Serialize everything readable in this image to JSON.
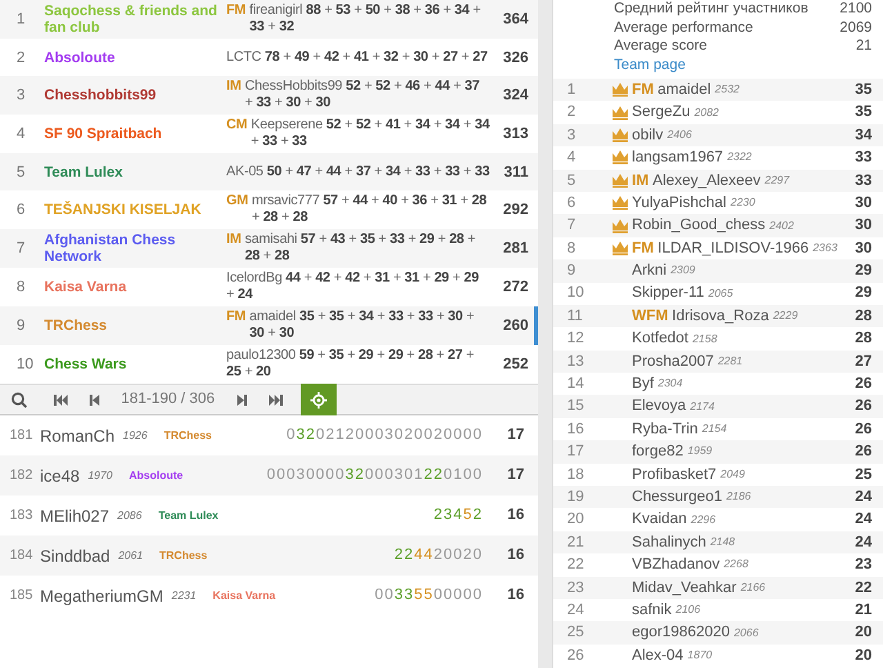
{
  "teams": [
    {
      "rank": "1",
      "name": "Saqochess & friends and fan club",
      "color": "#8cc63f",
      "title": "FM",
      "leader": "fireanigirl",
      "scores": "**88** + **53** + **50** + **38** + **36** + **34** + **33** + **32**",
      "total": "364",
      "selected": false
    },
    {
      "rank": "2",
      "name": "Absoloute",
      "color": "#a33cf0",
      "leader": "LCTC",
      "scores": "**78** + **49** + **42** + **41** + **32** + **30** + **27** + **27**",
      "total": "326",
      "selected": false
    },
    {
      "rank": "3",
      "name": "Chesshobbits99",
      "color": "#b03a34",
      "title": "IM",
      "leader": "ChessHobbits99",
      "scores": "**52** + **52** + **46** + **44** + **37** + **33** + **30** + **30**",
      "total": "324",
      "selected": false
    },
    {
      "rank": "4",
      "name": "SF 90 Spraitbach",
      "color": "#ec5a1e",
      "title": "CM",
      "leader": "Keepserene",
      "scores": "**52** + **52** + **41** + **34** + **34** + **34** + **33** + **33**",
      "total": "313",
      "selected": false
    },
    {
      "rank": "5",
      "name": "Team Lulex",
      "color": "#2e8b57",
      "leader": "AK-05",
      "scores": "**50** + **47** + **44** + **37** + **34** + **33** + **33** + **33**",
      "total": "311",
      "selected": false
    },
    {
      "rank": "6",
      "name": "TEŠANJSKI KISELJAK",
      "color": "#e0a224",
      "title": "GM",
      "leader": "mrsavic777",
      "scores": "**57** + **44** + **40** + **36** + **31** + **28** + **28** + **28**",
      "total": "292",
      "selected": false
    },
    {
      "rank": "7",
      "name": "Afghanistan Chess Network",
      "color": "#5c5cf0",
      "title": "IM",
      "leader": "samisahi",
      "scores": "**57** + **43** + **35** + **33** + **29** + **28** + **28** + **28**",
      "total": "281",
      "selected": false
    },
    {
      "rank": "8",
      "name": "Kaisa Varna",
      "color": "#e8735e",
      "leader": "IcelordBg",
      "scores": "**44** + **42** + **42** + **31** + **31** + **29** + **29** + **24**",
      "total": "272",
      "selected": false
    },
    {
      "rank": "9",
      "name": "TRChess",
      "color": "#d48a30",
      "title": "FM",
      "leader": "amaidel",
      "scores": "**35** + **35** + **34** + **33** + **33** + **30** + **30** + **30**",
      "total": "260",
      "selected": true
    },
    {
      "rank": "10",
      "name": "Chess Wars",
      "color": "#3c9a1e",
      "leader": "paulo12300",
      "scores": "**59** + **35** + **29** + **29** + **28** + **27** + **25** + **20**",
      "total": "252",
      "selected": false
    }
  ],
  "pager": {
    "range": "181-190 / 306"
  },
  "players": [
    {
      "rank": "181",
      "name": "RomanCh",
      "rating": "1926",
      "team": "TRChess",
      "color": "#d48a30",
      "sheet": [
        {
          "text": "0",
          "kind": "plain"
        },
        {
          "text": "32",
          "kind": "streak"
        },
        {
          "text": "02120003020020000",
          "kind": "plain"
        }
      ],
      "total": "17"
    },
    {
      "rank": "182",
      "name": "ice48",
      "rating": "1970",
      "team": "Absoloute",
      "color": "#a33cf0",
      "sheet": [
        {
          "text": "00030000",
          "kind": "plain"
        },
        {
          "text": "32",
          "kind": "streak"
        },
        {
          "text": "000301",
          "kind": "plain"
        },
        {
          "text": "22",
          "kind": "streak"
        },
        {
          "text": "0100",
          "kind": "plain"
        }
      ],
      "total": "17"
    },
    {
      "rank": "183",
      "name": "MElih027",
      "rating": "2086",
      "team": "Team Lulex",
      "color": "#2e8b57",
      "sheet": [
        {
          "text": "234",
          "kind": "streak"
        },
        {
          "text": "5",
          "kind": "double"
        },
        {
          "text": "2",
          "kind": "streak"
        }
      ],
      "total": "16"
    },
    {
      "rank": "184",
      "name": "Sinddbad",
      "rating": "2061",
      "team": "TRChess",
      "color": "#d48a30",
      "sheet": [
        {
          "text": "22",
          "kind": "streak"
        },
        {
          "text": "44",
          "kind": "double"
        },
        {
          "text": "20020",
          "kind": "plain"
        }
      ],
      "total": "16"
    },
    {
      "rank": "185",
      "name": "MegatheriumGM",
      "rating": "2231",
      "team": "Kaisa Varna",
      "color": "#e8735e",
      "sheet": [
        {
          "text": "00",
          "kind": "plain"
        },
        {
          "text": "33",
          "kind": "streak"
        },
        {
          "text": "55",
          "kind": "double"
        },
        {
          "text": "00000",
          "kind": "plain"
        }
      ],
      "total": "16"
    }
  ],
  "team_info": {
    "stats": [
      {
        "label": "Средний рейтинг участников",
        "value": "2100"
      },
      {
        "label": "Average performance",
        "value": "2069"
      },
      {
        "label": "Average score",
        "value": "21"
      }
    ],
    "link": "Team page"
  },
  "members": [
    {
      "rank": "1",
      "crown": true,
      "title": "FM",
      "name": "amaidel",
      "rating": "2532",
      "score": "35"
    },
    {
      "rank": "2",
      "crown": true,
      "name": "SergeZu",
      "rating": "2082",
      "score": "35"
    },
    {
      "rank": "3",
      "crown": true,
      "name": "obilv",
      "rating": "2406",
      "score": "34"
    },
    {
      "rank": "4",
      "crown": true,
      "name": "langsam1967",
      "rating": "2322",
      "score": "33"
    },
    {
      "rank": "5",
      "crown": true,
      "title": "IM",
      "name": "Alexey_Alexeev",
      "rating": "2297",
      "score": "33"
    },
    {
      "rank": "6",
      "crown": true,
      "name": "YulyaPishchal",
      "rating": "2230",
      "score": "30"
    },
    {
      "rank": "7",
      "crown": true,
      "name": "Robin_Good_chess",
      "rating": "2402",
      "score": "30"
    },
    {
      "rank": "8",
      "crown": true,
      "title": "FM",
      "name": "ILDAR_ILDISOV-1966",
      "rating": "2363",
      "score": "30"
    },
    {
      "rank": "9",
      "crown": false,
      "name": "Arkni",
      "rating": "2309",
      "score": "29"
    },
    {
      "rank": "10",
      "crown": false,
      "name": "Skipper-11",
      "rating": "2065",
      "score": "29"
    },
    {
      "rank": "11",
      "crown": false,
      "title": "WFM",
      "name": "Idrisova_Roza",
      "rating": "2229",
      "score": "28"
    },
    {
      "rank": "12",
      "crown": false,
      "name": "Kotfedot",
      "rating": "2158",
      "score": "28"
    },
    {
      "rank": "13",
      "crown": false,
      "name": "Prosha2007",
      "rating": "2281",
      "score": "27"
    },
    {
      "rank": "14",
      "crown": false,
      "name": "Byf",
      "rating": "2304",
      "score": "26"
    },
    {
      "rank": "15",
      "crown": false,
      "name": "Elevoya",
      "rating": "2174",
      "score": "26"
    },
    {
      "rank": "16",
      "crown": false,
      "name": "Ryba-Trin",
      "rating": "2154",
      "score": "26"
    },
    {
      "rank": "17",
      "crown": false,
      "name": "forge82",
      "rating": "1959",
      "score": "26"
    },
    {
      "rank": "18",
      "crown": false,
      "name": "Profibasket7",
      "rating": "2049",
      "score": "25"
    },
    {
      "rank": "19",
      "crown": false,
      "name": "Chessurgeo1",
      "rating": "2186",
      "score": "24"
    },
    {
      "rank": "20",
      "crown": false,
      "name": "Kvaidan",
      "rating": "2296",
      "score": "24"
    },
    {
      "rank": "21",
      "crown": false,
      "name": "Sahalinych",
      "rating": "2148",
      "score": "24"
    },
    {
      "rank": "22",
      "crown": false,
      "name": "VBZhadanov",
      "rating": "2268",
      "score": "23"
    },
    {
      "rank": "23",
      "crown": false,
      "name": "Midav_Veahkar",
      "rating": "2166",
      "score": "22"
    },
    {
      "rank": "24",
      "crown": false,
      "name": "safnik",
      "rating": "2106",
      "score": "21"
    },
    {
      "rank": "25",
      "crown": false,
      "name": "egor19862020",
      "rating": "2066",
      "score": "20"
    },
    {
      "rank": "26",
      "crown": false,
      "name": "Alex-04",
      "rating": "1870",
      "score": "20"
    }
  ]
}
